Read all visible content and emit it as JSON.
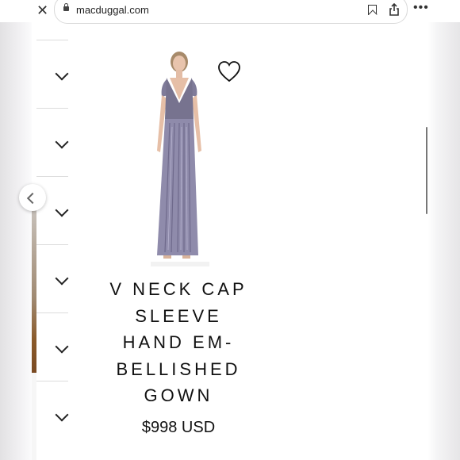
{
  "browser": {
    "url": "macduggal.com",
    "close_icon": "close-icon",
    "actions": [
      "bookmark-icon",
      "share-icon",
      "more-icon"
    ]
  },
  "product": {
    "title": "V NECK CAP SLEEVE HAND EM-BELLISHED GOWN",
    "title_lines": [
      "V NECK CAP",
      "SLEEVE",
      "HAND EM-",
      "BELLISHED",
      "GOWN"
    ],
    "price": "$998 USD"
  },
  "accordion": {
    "rows": 6
  },
  "colors": {
    "gown": "#8f8bab",
    "accent": "#111111"
  }
}
